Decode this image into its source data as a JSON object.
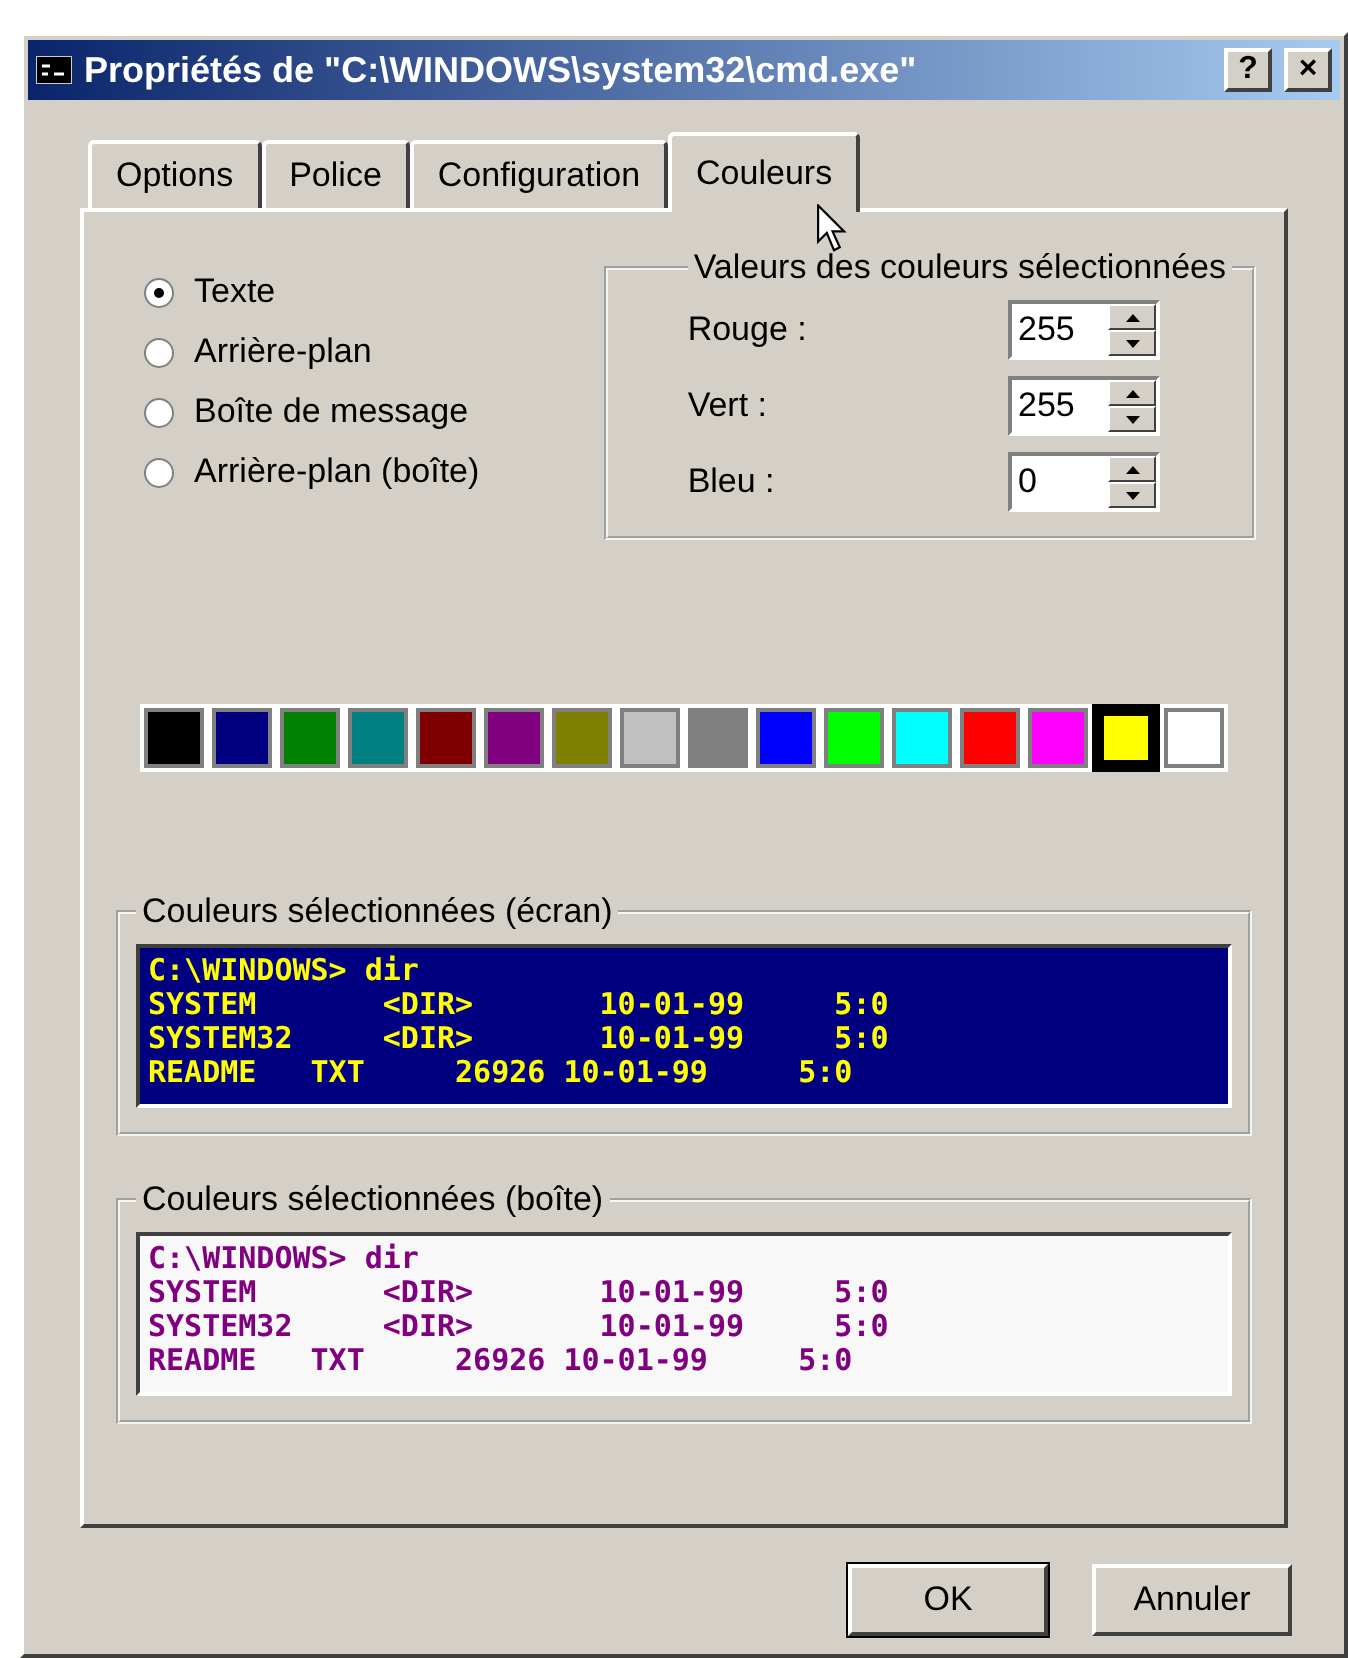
{
  "window": {
    "title": "Propriétés de \"C:\\WINDOWS\\system32\\cmd.exe\"",
    "help_button": "?",
    "close_button": "×"
  },
  "tabs": [
    {
      "label": "Options",
      "selected": false
    },
    {
      "label": "Police",
      "selected": false
    },
    {
      "label": "Configuration",
      "selected": false
    },
    {
      "label": "Couleurs",
      "selected": true
    }
  ],
  "targets": [
    {
      "label": "Texte",
      "selected": true
    },
    {
      "label": "Arrière-plan",
      "selected": false
    },
    {
      "label": "Boîte de message",
      "selected": false
    },
    {
      "label": "Arrière-plan (boîte)",
      "selected": false
    }
  ],
  "values_group": {
    "title": "Valeurs des couleurs sélectionnées",
    "fields": [
      {
        "label": "Rouge :",
        "value": "255"
      },
      {
        "label": "Vert :",
        "value": "255"
      },
      {
        "label": "Bleu :",
        "value": "0"
      }
    ]
  },
  "palette": [
    {
      "color": "#000000",
      "selected": false
    },
    {
      "color": "#000080",
      "selected": false
    },
    {
      "color": "#008000",
      "selected": false
    },
    {
      "color": "#008080",
      "selected": false
    },
    {
      "color": "#800000",
      "selected": false
    },
    {
      "color": "#800080",
      "selected": false
    },
    {
      "color": "#808000",
      "selected": false
    },
    {
      "color": "#c0c0c0",
      "selected": false
    },
    {
      "color": "#808080",
      "selected": false
    },
    {
      "color": "#0000ff",
      "selected": false
    },
    {
      "color": "#00ff00",
      "selected": false
    },
    {
      "color": "#00ffff",
      "selected": false
    },
    {
      "color": "#ff0000",
      "selected": false
    },
    {
      "color": "#ff00ff",
      "selected": false
    },
    {
      "color": "#ffff00",
      "selected": true
    },
    {
      "color": "#ffffff",
      "selected": false
    }
  ],
  "previews": [
    {
      "title": "Couleurs sélectionnées (écran)",
      "kind": "screen",
      "lines": [
        "C:\\WINDOWS> dir",
        "SYSTEM       <DIR>       10-01-99     5:0",
        "SYSTEM32     <DIR>       10-01-99     5:0",
        "README   TXT     26926 10-01-99     5:0"
      ]
    },
    {
      "title": "Couleurs sélectionnées (boîte)",
      "kind": "popup",
      "lines": [
        "C:\\WINDOWS> dir",
        "SYSTEM       <DIR>       10-01-99     5:0",
        "SYSTEM32     <DIR>       10-01-99     5:0",
        "README   TXT     26926 10-01-99     5:0"
      ]
    }
  ],
  "buttons": [
    {
      "label": "OK",
      "default": true
    },
    {
      "label": "Annuler",
      "default": false
    }
  ]
}
